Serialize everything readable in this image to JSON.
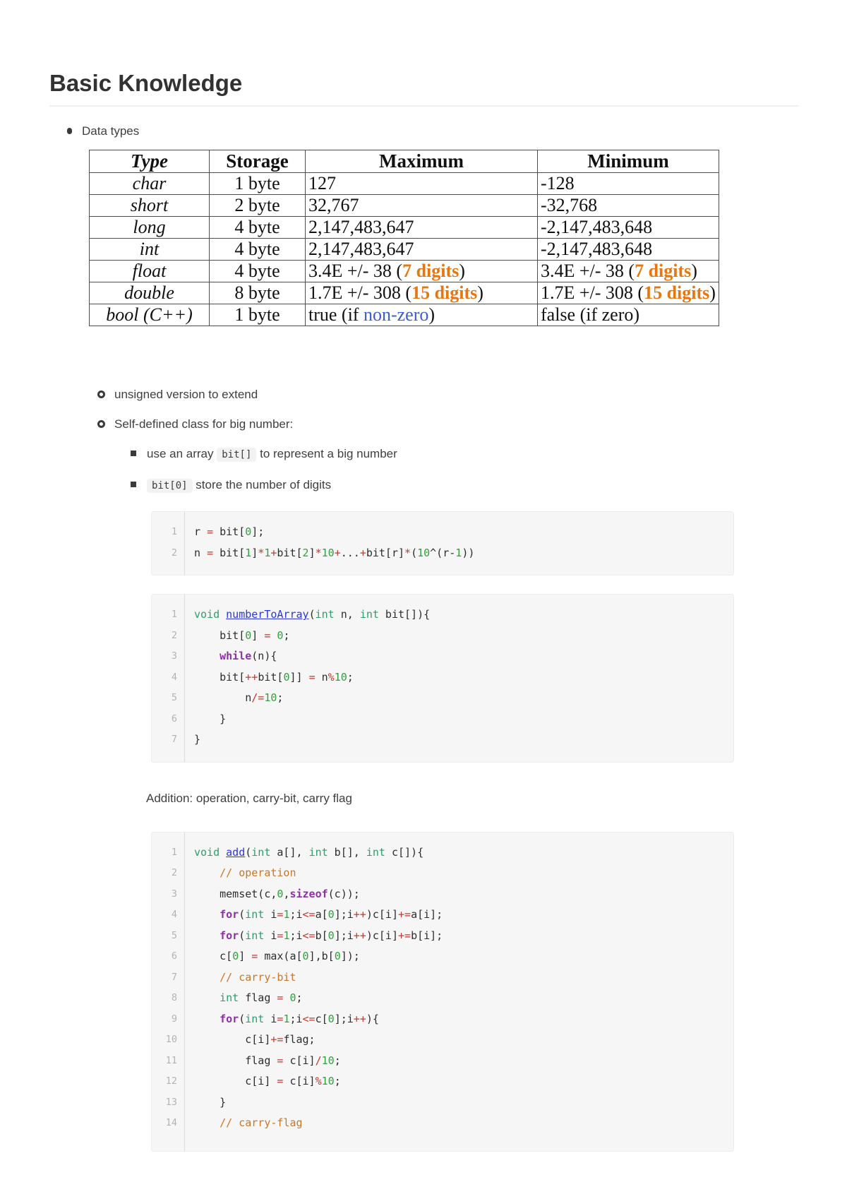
{
  "title": "Basic Knowledge",
  "list": {
    "item1": "Data types",
    "item2": "unsigned version to extend",
    "item3": "Self-defined class for big number:",
    "item4": [
      {
        "t": "use an array "
      },
      {
        "t": "bit[]",
        "s": "code"
      },
      {
        "t": " to represent a big number"
      }
    ],
    "item5": [
      {
        "t": "bit[0]",
        "s": "code"
      },
      {
        "t": " store the number of digits"
      }
    ]
  },
  "paragraph": "Addition: operation, carry-bit, carry flag",
  "table": {
    "headers": [
      "Type",
      "Storage",
      "Maximum",
      "Minimum"
    ],
    "rows": [
      {
        "type": "char",
        "storage": "1 byte",
        "max": [
          {
            "t": "127"
          }
        ],
        "min": [
          {
            "t": "-128"
          }
        ]
      },
      {
        "type": "short",
        "storage": "2 byte",
        "max": [
          {
            "t": "32,767"
          }
        ],
        "min": [
          {
            "t": "-32,768"
          }
        ]
      },
      {
        "type": "long",
        "storage": "4 byte",
        "max": [
          {
            "t": "2,147,483,647"
          }
        ],
        "min": [
          {
            "t": "-2,147,483,648"
          }
        ]
      },
      {
        "type": "int",
        "storage": "4 byte",
        "max": [
          {
            "t": "2,147,483,647"
          }
        ],
        "min": [
          {
            "t": "-2,147,483,648"
          }
        ]
      },
      {
        "type": "float",
        "storage": "4 byte",
        "max": [
          {
            "t": "3.4E +/- 38 ("
          },
          {
            "t": "7 digits",
            "s": "orange"
          },
          {
            "t": ")"
          }
        ],
        "min": [
          {
            "t": "3.4E +/- 38 ("
          },
          {
            "t": "7 digits",
            "s": "orange"
          },
          {
            "t": ")"
          }
        ]
      },
      {
        "type": "double",
        "storage": "8 byte",
        "max": [
          {
            "t": "1.7E +/- 308 ("
          },
          {
            "t": "15 digits",
            "s": "orange"
          },
          {
            "t": ")"
          }
        ],
        "min": [
          {
            "t": "1.7E +/- 308 ("
          },
          {
            "t": "15 digits",
            "s": "orange"
          },
          {
            "t": ")"
          }
        ]
      },
      {
        "type": "bool (C++)",
        "storage": "1 byte",
        "max": [
          {
            "t": "true (if "
          },
          {
            "t": "non-zero",
            "s": "blue"
          },
          {
            "t": ")"
          }
        ],
        "min": [
          {
            "t": "false (if zero)"
          }
        ]
      }
    ]
  },
  "code_blocks": [
    {
      "lines": [
        {
          "n": "1",
          "t": [
            {
              "x": "r "
            },
            {
              "x": "=",
              "c": "op"
            },
            {
              "x": " bit["
            },
            {
              "x": "0",
              "c": "num"
            },
            {
              "x": "];"
            }
          ]
        },
        {
          "n": "2",
          "t": [
            {
              "x": "n "
            },
            {
              "x": "=",
              "c": "op"
            },
            {
              "x": " bit["
            },
            {
              "x": "1",
              "c": "num"
            },
            {
              "x": "]"
            },
            {
              "x": "*",
              "c": "op"
            },
            {
              "x": "1",
              "c": "num"
            },
            {
              "x": "+",
              "c": "op"
            },
            {
              "x": "bit["
            },
            {
              "x": "2",
              "c": "num"
            },
            {
              "x": "]"
            },
            {
              "x": "*",
              "c": "op"
            },
            {
              "x": "10",
              "c": "num"
            },
            {
              "x": "+",
              "c": "op"
            },
            {
              "x": "..."
            },
            {
              "x": "+",
              "c": "op"
            },
            {
              "x": "bit[r]"
            },
            {
              "x": "*",
              "c": "op"
            },
            {
              "x": "("
            },
            {
              "x": "10",
              "c": "num"
            },
            {
              "x": "^(r-"
            },
            {
              "x": "1",
              "c": "num"
            },
            {
              "x": "))"
            }
          ]
        }
      ]
    },
    {
      "lines": [
        {
          "n": "1",
          "t": [
            {
              "x": "void",
              "c": "k"
            },
            {
              "x": " "
            },
            {
              "x": "numberToArray",
              "c": "fn"
            },
            {
              "x": "("
            },
            {
              "x": "int",
              "c": "k"
            },
            {
              "x": " n, "
            },
            {
              "x": "int",
              "c": "k"
            },
            {
              "x": " bit[]){"
            }
          ]
        },
        {
          "n": "2",
          "t": [
            {
              "x": "    bit["
            },
            {
              "x": "0",
              "c": "num"
            },
            {
              "x": "] "
            },
            {
              "x": "=",
              "c": "op"
            },
            {
              "x": " "
            },
            {
              "x": "0",
              "c": "num"
            },
            {
              "x": ";"
            }
          ]
        },
        {
          "n": "3",
          "t": [
            {
              "x": "    "
            },
            {
              "x": "while",
              "c": "kw"
            },
            {
              "x": "(n){"
            }
          ]
        },
        {
          "n": "4",
          "t": [
            {
              "x": "    bit["
            },
            {
              "x": "++",
              "c": "op"
            },
            {
              "x": "bit["
            },
            {
              "x": "0",
              "c": "num"
            },
            {
              "x": "]] "
            },
            {
              "x": "=",
              "c": "op"
            },
            {
              "x": " n"
            },
            {
              "x": "%",
              "c": "op"
            },
            {
              "x": "10",
              "c": "num"
            },
            {
              "x": ";"
            }
          ]
        },
        {
          "n": "5",
          "t": [
            {
              "x": "        n"
            },
            {
              "x": "/=",
              "c": "op"
            },
            {
              "x": "10",
              "c": "num"
            },
            {
              "x": ";"
            }
          ]
        },
        {
          "n": "6",
          "t": [
            {
              "x": "    }"
            }
          ]
        },
        {
          "n": "7",
          "t": [
            {
              "x": "}"
            }
          ]
        }
      ]
    },
    {
      "lines": [
        {
          "n": "1",
          "t": [
            {
              "x": "void",
              "c": "k"
            },
            {
              "x": " "
            },
            {
              "x": "add",
              "c": "fn"
            },
            {
              "x": "("
            },
            {
              "x": "int",
              "c": "k"
            },
            {
              "x": " a[], "
            },
            {
              "x": "int",
              "c": "k"
            },
            {
              "x": " b[], "
            },
            {
              "x": "int",
              "c": "k"
            },
            {
              "x": " c[]){"
            }
          ]
        },
        {
          "n": "2",
          "t": [
            {
              "x": "    "
            },
            {
              "x": "// operation",
              "c": "com"
            }
          ]
        },
        {
          "n": "3",
          "t": [
            {
              "x": "    memset(c,"
            },
            {
              "x": "0",
              "c": "num"
            },
            {
              "x": ","
            },
            {
              "x": "sizeof",
              "c": "kw"
            },
            {
              "x": "(c));"
            }
          ]
        },
        {
          "n": "4",
          "t": [
            {
              "x": "    "
            },
            {
              "x": "for",
              "c": "kw"
            },
            {
              "x": "("
            },
            {
              "x": "int",
              "c": "k"
            },
            {
              "x": " i"
            },
            {
              "x": "=",
              "c": "op"
            },
            {
              "x": "1",
              "c": "num"
            },
            {
              "x": ";i"
            },
            {
              "x": "<=",
              "c": "op"
            },
            {
              "x": "a["
            },
            {
              "x": "0",
              "c": "num"
            },
            {
              "x": "];i"
            },
            {
              "x": "++",
              "c": "op"
            },
            {
              "x": ")c[i]"
            },
            {
              "x": "+=",
              "c": "op"
            },
            {
              "x": "a[i];"
            }
          ]
        },
        {
          "n": "5",
          "t": [
            {
              "x": "    "
            },
            {
              "x": "for",
              "c": "kw"
            },
            {
              "x": "("
            },
            {
              "x": "int",
              "c": "k"
            },
            {
              "x": " i"
            },
            {
              "x": "=",
              "c": "op"
            },
            {
              "x": "1",
              "c": "num"
            },
            {
              "x": ";i"
            },
            {
              "x": "<=",
              "c": "op"
            },
            {
              "x": "b["
            },
            {
              "x": "0",
              "c": "num"
            },
            {
              "x": "];i"
            },
            {
              "x": "++",
              "c": "op"
            },
            {
              "x": ")c[i]"
            },
            {
              "x": "+=",
              "c": "op"
            },
            {
              "x": "b[i];"
            }
          ]
        },
        {
          "n": "6",
          "t": [
            {
              "x": "    c["
            },
            {
              "x": "0",
              "c": "num"
            },
            {
              "x": "] "
            },
            {
              "x": "=",
              "c": "op"
            },
            {
              "x": " max(a["
            },
            {
              "x": "0",
              "c": "num"
            },
            {
              "x": "],b["
            },
            {
              "x": "0",
              "c": "num"
            },
            {
              "x": "]);"
            }
          ]
        },
        {
          "n": "7",
          "t": [
            {
              "x": "    "
            },
            {
              "x": "// carry-bit",
              "c": "com"
            }
          ]
        },
        {
          "n": "8",
          "t": [
            {
              "x": "    "
            },
            {
              "x": "int",
              "c": "k"
            },
            {
              "x": " flag "
            },
            {
              "x": "=",
              "c": "op"
            },
            {
              "x": " "
            },
            {
              "x": "0",
              "c": "num"
            },
            {
              "x": ";"
            }
          ]
        },
        {
          "n": "9",
          "t": [
            {
              "x": "    "
            },
            {
              "x": "for",
              "c": "kw"
            },
            {
              "x": "("
            },
            {
              "x": "int",
              "c": "k"
            },
            {
              "x": " i"
            },
            {
              "x": "=",
              "c": "op"
            },
            {
              "x": "1",
              "c": "num"
            },
            {
              "x": ";i"
            },
            {
              "x": "<=",
              "c": "op"
            },
            {
              "x": "c["
            },
            {
              "x": "0",
              "c": "num"
            },
            {
              "x": "];i"
            },
            {
              "x": "++",
              "c": "op"
            },
            {
              "x": "){"
            }
          ]
        },
        {
          "n": "10",
          "t": [
            {
              "x": "        c[i]"
            },
            {
              "x": "+=",
              "c": "op"
            },
            {
              "x": "flag;"
            }
          ]
        },
        {
          "n": "11",
          "t": [
            {
              "x": "        flag "
            },
            {
              "x": "=",
              "c": "op"
            },
            {
              "x": " c[i]"
            },
            {
              "x": "/",
              "c": "op"
            },
            {
              "x": "10",
              "c": "num"
            },
            {
              "x": ";"
            }
          ]
        },
        {
          "n": "12",
          "t": [
            {
              "x": "        c[i] "
            },
            {
              "x": "=",
              "c": "op"
            },
            {
              "x": " c[i]"
            },
            {
              "x": "%",
              "c": "op"
            },
            {
              "x": "10",
              "c": "num"
            },
            {
              "x": ";"
            }
          ]
        },
        {
          "n": "13",
          "t": [
            {
              "x": "    }"
            }
          ]
        },
        {
          "n": "14",
          "t": [
            {
              "x": "    "
            },
            {
              "x": "// carry-flag",
              "c": "com"
            }
          ]
        }
      ]
    }
  ],
  "colors": {
    "syntax_keyword": "#2f9c6c",
    "syntax_flow_keyword": "#8e2fa8",
    "syntax_function": "#2b36d9",
    "syntax_number": "#2fa13c",
    "syntax_operator": "#c2392e",
    "syntax_comment": "#c87629",
    "table_highlight_orange": "#e8760d",
    "table_link_blue": "#3a5fcd",
    "code_background": "#f6f6f6"
  }
}
